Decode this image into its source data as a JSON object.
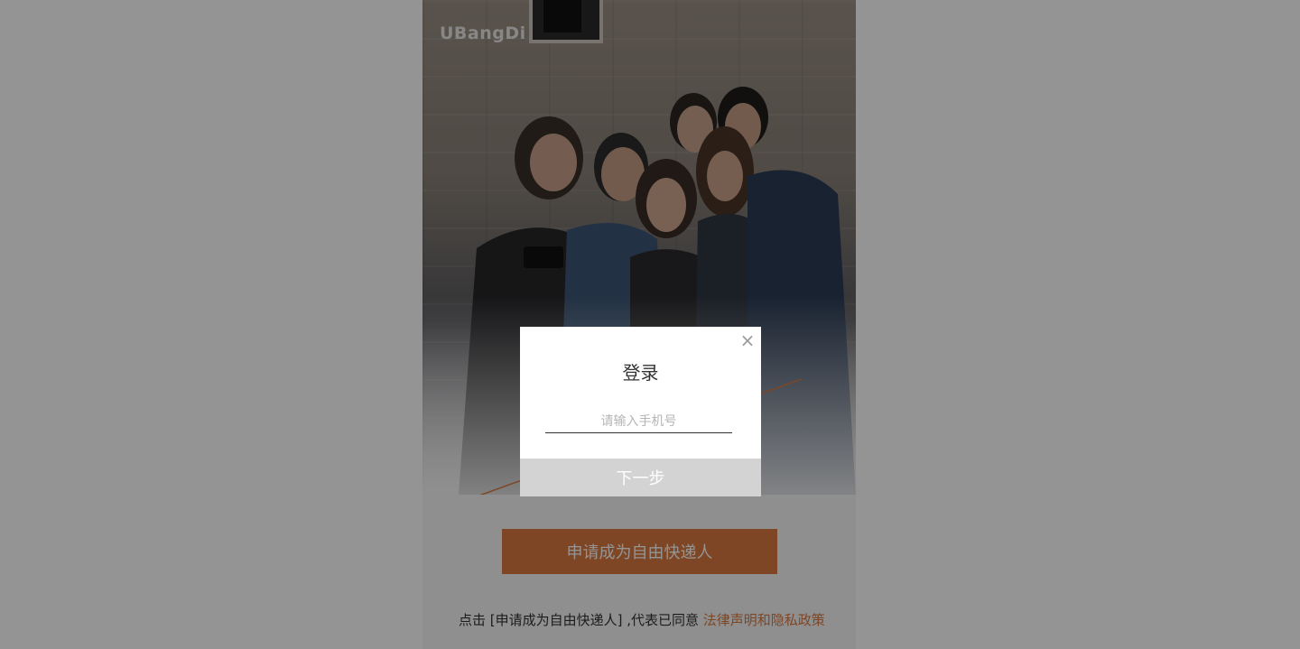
{
  "brand": {
    "logo_text": "UBangDi"
  },
  "page": {
    "apply_button_label": "申请成为自由快递人",
    "agreement_prefix": "点击 [申请成为自由快递人] ,代表已同意",
    "agreement_link": "法律声明和隐私政策"
  },
  "modal": {
    "title": "登录",
    "close_label": "×",
    "phone_placeholder": "请输入手机号",
    "phone_value": "",
    "next_button_label": "下一步"
  },
  "colors": {
    "accent": "#d9793f",
    "overlay": "rgba(0,0,0,0.42)",
    "disabled_button": "#d3d3d3"
  },
  "icons": {
    "close": "close-icon"
  }
}
